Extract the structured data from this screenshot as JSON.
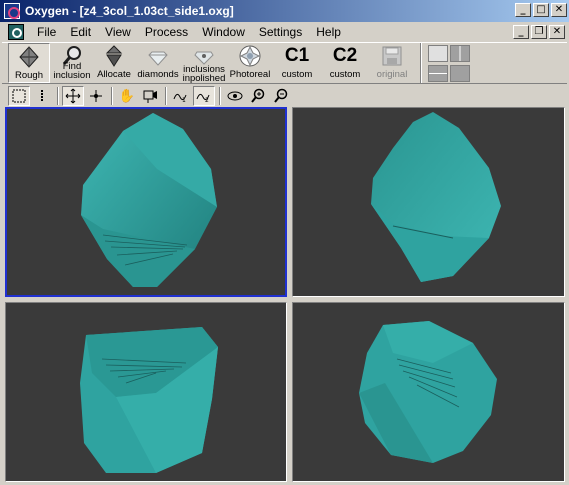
{
  "window": {
    "title": "Oxygen - [z4_3col_1.03ct_side1.oxg]",
    "buttons": {
      "minimize": "_",
      "maximize": "□",
      "close": "✕"
    }
  },
  "menu": {
    "items": [
      "File",
      "Edit",
      "View",
      "Process",
      "Window",
      "Settings",
      "Help"
    ],
    "doc_buttons": {
      "minimize": "_",
      "restore": "❐",
      "close": "✕"
    }
  },
  "toolbar": {
    "rough": "Rough",
    "find_inclusion_1": "Find",
    "find_inclusion_2": "inclusion",
    "allocate": "Allocate",
    "diamonds": "diamonds",
    "inclusions_1": "inclusions",
    "inclusions_2": "inpolished",
    "photoreal": "Photoreal",
    "c1_icon": "C1",
    "c1_label": "custom",
    "c2_icon": "C2",
    "c2_label": "custom",
    "original": "original"
  },
  "colors": {
    "title_start": "#0a246a",
    "title_end": "#a6caf0",
    "viewport_bg": "#3a3a3a",
    "stone": "#2fa3a0",
    "active_border": "#2030d0"
  },
  "viewports": [
    {
      "name": "top-left",
      "active": true
    },
    {
      "name": "top-right",
      "active": false
    },
    {
      "name": "bottom-left",
      "active": false
    },
    {
      "name": "bottom-right",
      "active": false
    }
  ]
}
